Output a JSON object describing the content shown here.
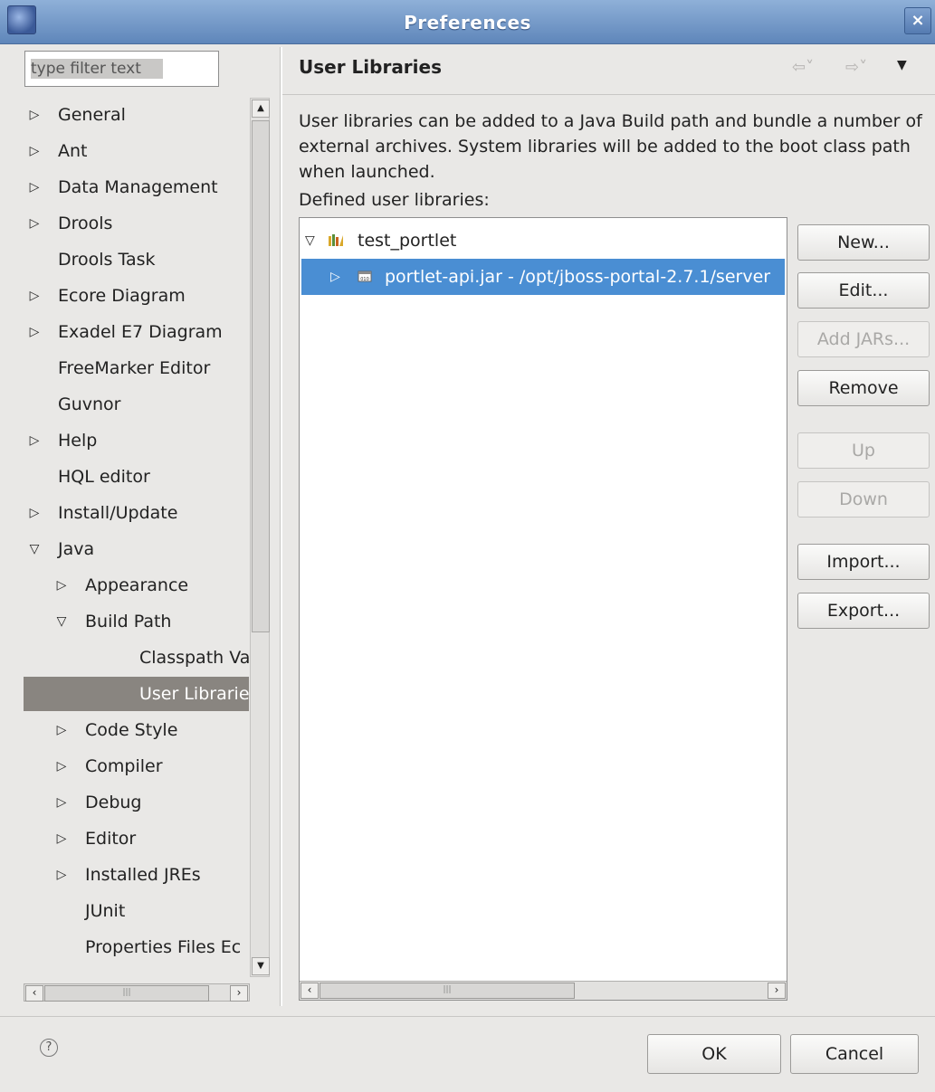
{
  "window": {
    "title": "Preferences",
    "close_glyph": "×"
  },
  "filter": {
    "placeholder": "type filter text"
  },
  "tree": {
    "items": [
      {
        "label": "General",
        "expander": "▷"
      },
      {
        "label": "Ant",
        "expander": "▷"
      },
      {
        "label": "Data Management",
        "expander": "▷"
      },
      {
        "label": "Drools",
        "expander": "▷"
      },
      {
        "label": "Drools Task",
        "expander": ""
      },
      {
        "label": "Ecore Diagram",
        "expander": "▷"
      },
      {
        "label": "Exadel E7 Diagram",
        "expander": "▷"
      },
      {
        "label": "FreeMarker Editor",
        "expander": ""
      },
      {
        "label": "Guvnor",
        "expander": ""
      },
      {
        "label": "Help",
        "expander": "▷"
      },
      {
        "label": "HQL editor",
        "expander": ""
      },
      {
        "label": "Install/Update",
        "expander": "▷"
      },
      {
        "label": "Java",
        "expander": "▽"
      },
      {
        "label": "Appearance",
        "expander": "▷"
      },
      {
        "label": "Build Path",
        "expander": "▽"
      },
      {
        "label": "Classpath Varia",
        "expander": ""
      },
      {
        "label": "User Libraries",
        "expander": "",
        "selected": true
      },
      {
        "label": "Code Style",
        "expander": "▷"
      },
      {
        "label": "Compiler",
        "expander": "▷"
      },
      {
        "label": "Debug",
        "expander": "▷"
      },
      {
        "label": "Editor",
        "expander": "▷"
      },
      {
        "label": "Installed JREs",
        "expander": "▷"
      },
      {
        "label": "JUnit",
        "expander": ""
      },
      {
        "label": "Properties Files Ec",
        "expander": ""
      }
    ]
  },
  "page": {
    "title": "User Libraries",
    "nav_back": "⇦˅",
    "nav_forward": "⇨˅",
    "nav_menu": "▼",
    "description": "User libraries can be added to a Java Build path and bundle a number of external archives. System libraries will be added to the boot class path when launched.",
    "defined_label": "Defined user libraries:"
  },
  "libraries": {
    "rows": [
      {
        "label": "test_portlet",
        "expander": "▽"
      },
      {
        "label": "portlet-api.jar - /opt/jboss-portal-2.7.1/server",
        "expander": "▷",
        "selected": true
      }
    ]
  },
  "buttons": {
    "new": "New...",
    "edit": "Edit...",
    "add_jars": "Add JARs...",
    "remove": "Remove",
    "up": "Up",
    "down": "Down",
    "import": "Import...",
    "export": "Export...",
    "ok": "OK",
    "cancel": "Cancel"
  },
  "icons": {
    "help": "help-icon",
    "library": "library-icon",
    "jar": "jar-icon"
  },
  "colors": {
    "titlebar": "#6f93c4",
    "tree_selection": "#898580",
    "list_selection": "#4a8ed3"
  }
}
